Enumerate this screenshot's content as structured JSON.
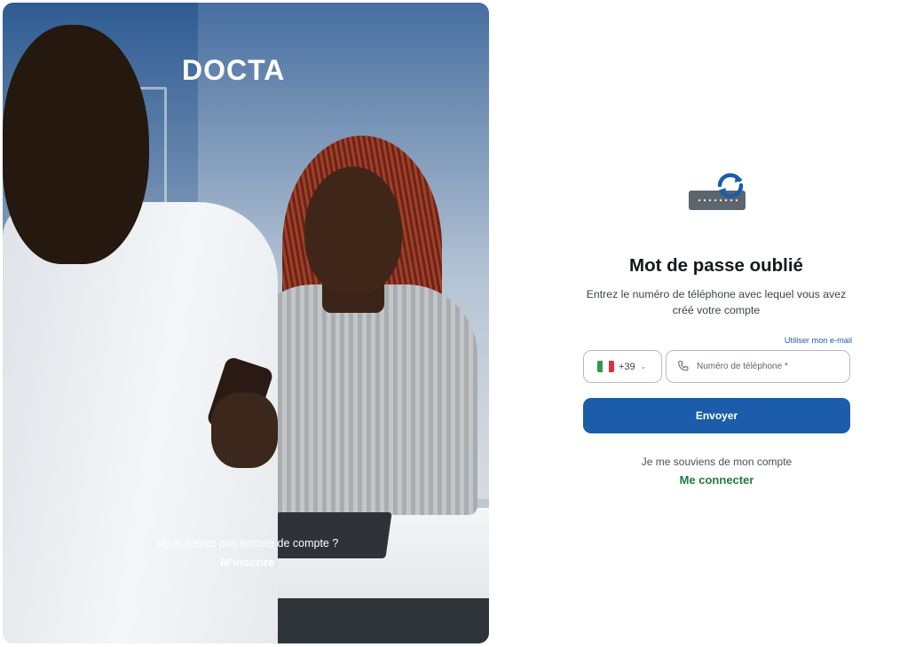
{
  "brand": {
    "logo_text": "DOCTA",
    "logo_icon": "docta-logo-icon"
  },
  "hero": {
    "no_account_text": "Vous n'avez pas encore de compte ?",
    "signup_label": "M'inscrire"
  },
  "form": {
    "illustration_icon": "password-reset-icon",
    "title": "Mot de passe oublié",
    "subtitle": "Entrez le numéro de téléphone avec lequel vous avez créé votre compte",
    "use_email_label": "Utiliser mon e-mail",
    "country": {
      "flag": "italy-flag-icon",
      "dial_code": "+39",
      "chevron": "chevron-down-icon"
    },
    "phone": {
      "icon": "phone-icon",
      "placeholder": "Numéro de téléphone *",
      "value": ""
    },
    "submit_label": "Envoyer",
    "remember_text": "Je me souviens de mon compte",
    "login_label": "Me connecter"
  },
  "colors": {
    "primary": "#1b5cab",
    "success_link": "#1f7a3c",
    "title_text": "#14171d",
    "flag_green": "#2f9b48",
    "flag_white": "#ffffff",
    "flag_red": "#d8343c"
  }
}
